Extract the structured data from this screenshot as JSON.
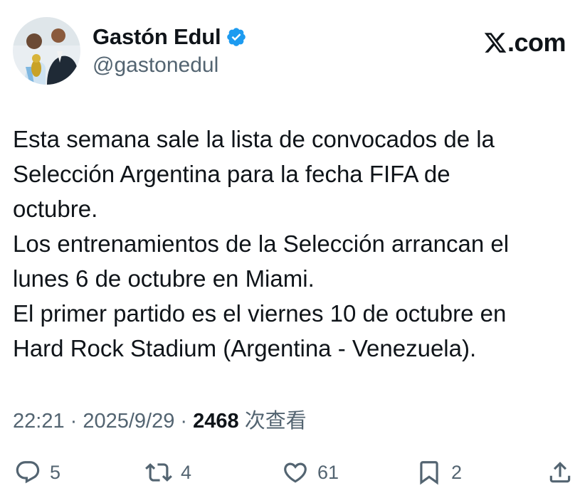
{
  "author": {
    "display_name": "Gastón Edul",
    "handle": "@gastonedul",
    "verified": true
  },
  "brand": {
    "text": ".com",
    "logo_icon": "x-logo-icon"
  },
  "tweet": {
    "lines": [
      "Esta semana sale la lista de convocados de la",
      "Selección Argentina para la fecha FIFA de",
      "octubre.",
      "Los entrenamientos de la Selección arrancan el",
      "lunes 6 de octubre en Miami.",
      "El primer partido es el viernes 10 de octubre en",
      "Hard Rock Stadium (Argentina - Venezuela)."
    ]
  },
  "meta": {
    "time": "22:21",
    "separator": " · ",
    "date": "2025/9/29",
    "views_count": "2468",
    "views_label": "次查看"
  },
  "actions": {
    "replies": "5",
    "reposts": "4",
    "likes": "61",
    "bookmarks": "2"
  },
  "colors": {
    "text_primary": "#0f1419",
    "text_secondary": "#536471",
    "verified_blue": "#1d9bf0"
  }
}
